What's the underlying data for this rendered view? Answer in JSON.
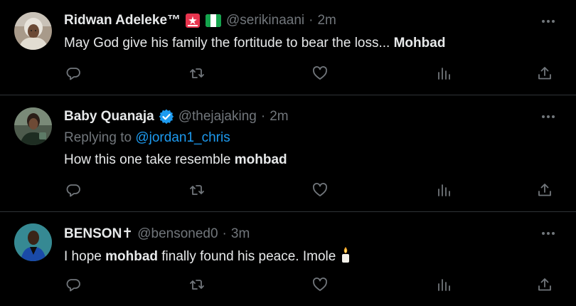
{
  "tweets": [
    {
      "name": "Ridwan Adeleke™",
      "handle": "@serikinaani",
      "sep": "·",
      "time": "2m",
      "text_before": "May God give his family the fortitude to bear the loss... ",
      "text_bold": "Mohbad",
      "text_after": "",
      "badges": [
        "siren-emoji-icon",
        "nigeria-flag-icon"
      ]
    },
    {
      "name": "Baby Quanaja",
      "handle": "@thejajaking",
      "sep": "·",
      "time": "2m",
      "replying_prefix": "Replying to ",
      "replying_to": "@jordan1_chris",
      "text_before": "How this one take resemble ",
      "text_bold": "mohbad",
      "text_after": "",
      "badges": [
        "verified-badge-icon"
      ]
    },
    {
      "name": "BENSON✝",
      "handle": "@bensoned0",
      "sep": "·",
      "time": "3m",
      "text_before": "I hope ",
      "text_bold": "mohbad",
      "text_after": " finally found his peace. Imole ",
      "trailing_emoji": "candle-icon",
      "badges": []
    }
  ],
  "colors": {
    "background": "#000000",
    "text": "#e7e9ea",
    "muted": "#71767b",
    "link": "#1d9bf0",
    "divider": "#2f3336",
    "verified": "#1d9bf0"
  }
}
